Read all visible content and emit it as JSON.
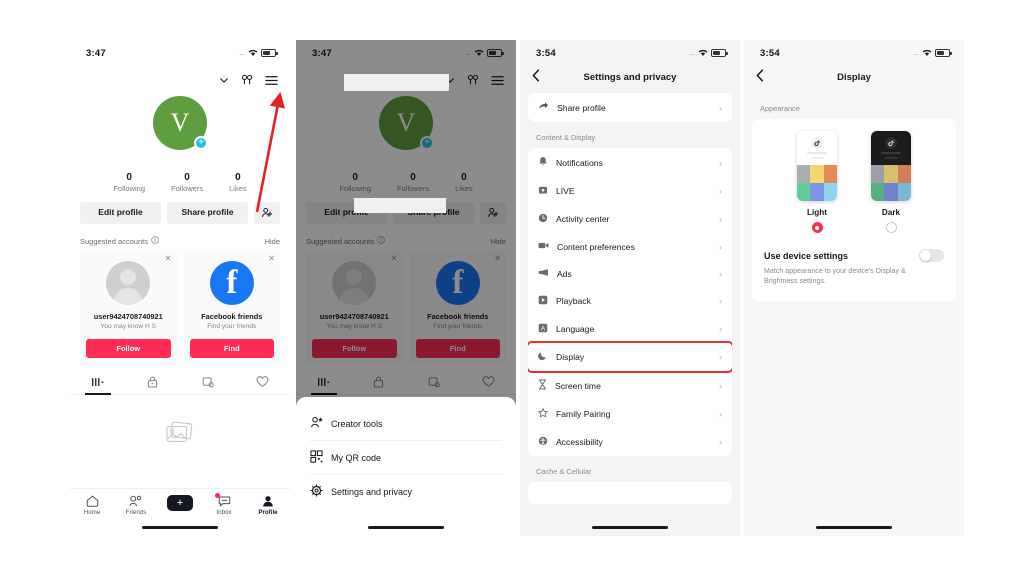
{
  "panels": {
    "profile": {
      "status": {
        "time": "3:47",
        "dots": "....",
        "wifi_icon": "wifi-icon",
        "battery_icon": "battery-icon"
      },
      "header": {
        "chevron_icon": "chevron-down-icon",
        "friends_icon": "add-friends-icon",
        "menu_icon": "hamburger-menu-icon"
      },
      "avatar": {
        "letter": "V",
        "bg_color": "#5f9e3f",
        "badge_icon": "plus-badge-icon"
      },
      "stats": [
        {
          "value": "0",
          "label": "Following"
        },
        {
          "value": "0",
          "label": "Followers"
        },
        {
          "value": "0",
          "label": "Likes"
        }
      ],
      "buttons": {
        "edit": "Edit profile",
        "share": "Share profile",
        "add_icon": "add-person-icon"
      },
      "suggested": {
        "title": "Suggested accounts",
        "info_icon": "info-icon",
        "hide": "Hide",
        "cards": [
          {
            "avatar_icon": "default-user-avatar",
            "name": "user9424708740921",
            "sub": "You may know H S",
            "cta": "Follow",
            "close_icon": "close-icon"
          },
          {
            "avatar_icon": "facebook-logo",
            "name": "Facebook friends",
            "sub": "Find your friends",
            "cta": "Find",
            "close_icon": "close-icon"
          }
        ]
      },
      "tabs": [
        {
          "icon": "grid-posts-icon",
          "active": true
        },
        {
          "icon": "lock-private-icon",
          "active": false
        },
        {
          "icon": "repost-icon",
          "active": false
        },
        {
          "icon": "heart-liked-icon",
          "active": false
        }
      ],
      "empty_icon": "photo-placeholder-icon",
      "bottom_nav": [
        {
          "icon": "home-icon",
          "label": "Home",
          "active": false
        },
        {
          "icon": "friends-icon",
          "label": "Friends",
          "active": false
        },
        {
          "icon": "create-plus-icon",
          "label": "",
          "active": false
        },
        {
          "icon": "inbox-icon",
          "label": "Inbox",
          "active": false,
          "badge": true
        },
        {
          "icon": "profile-icon",
          "label": "Profile",
          "active": true
        }
      ]
    },
    "menu": {
      "status": {
        "time": "3:47",
        "dots": "...."
      },
      "items": [
        {
          "icon": "creator-tools-icon",
          "label": "Creator tools"
        },
        {
          "icon": "qr-code-icon",
          "label": "My QR code"
        },
        {
          "icon": "settings-gear-icon",
          "label": "Settings and privacy"
        }
      ]
    },
    "settings": {
      "status": {
        "time": "3:54",
        "dots": "...."
      },
      "title": "Settings and privacy",
      "back_icon": "back-chevron-icon",
      "top_group": [
        {
          "icon": "share-arrow-icon",
          "label": "Share profile",
          "chevron": "›"
        }
      ],
      "section_label": "Content & Display",
      "items": [
        {
          "icon": "bell-icon",
          "label": "Notifications",
          "chevron": "›",
          "highlighted": false
        },
        {
          "icon": "live-icon",
          "label": "LIVE",
          "chevron": "›",
          "highlighted": false
        },
        {
          "icon": "clock-icon",
          "label": "Activity center",
          "chevron": "›",
          "highlighted": false
        },
        {
          "icon": "video-camera-icon",
          "label": "Content preferences",
          "chevron": "›",
          "highlighted": false
        },
        {
          "icon": "megaphone-icon",
          "label": "Ads",
          "chevron": "›",
          "highlighted": false
        },
        {
          "icon": "playback-icon",
          "label": "Playback",
          "chevron": "›",
          "highlighted": false
        },
        {
          "icon": "language-icon",
          "label": "Language",
          "chevron": "›",
          "highlighted": false
        },
        {
          "icon": "moon-display-icon",
          "label": "Display",
          "chevron": "›",
          "highlighted": true
        },
        {
          "icon": "hourglass-icon",
          "label": "Screen time",
          "chevron": "›",
          "highlighted": false
        },
        {
          "icon": "family-pairing-icon",
          "label": "Family Pairing",
          "chevron": "›",
          "highlighted": false
        },
        {
          "icon": "accessibility-icon",
          "label": "Accessibility",
          "chevron": "›",
          "highlighted": false
        }
      ],
      "bottom_section_label": "Cache & Cellular"
    },
    "display": {
      "status": {
        "time": "3:54",
        "dots": "...."
      },
      "title": "Display",
      "back_icon": "back-chevron-icon",
      "section_label": "Appearance",
      "themes": [
        {
          "label": "Light",
          "selected": true,
          "preview_bg": "#ffffff",
          "logo_icon": "tiktok-note-icon",
          "swatches": [
            "#a9aeb3",
            "#f5d76e",
            "#e8895a",
            "#5ecf9a",
            "#7b93e8",
            "#8fd4ef"
          ]
        },
        {
          "label": "Dark",
          "selected": false,
          "preview_bg": "#1c1c1e",
          "logo_icon": "tiktok-note-icon",
          "swatches": [
            "#9aa0a6",
            "#d6c06a",
            "#cf8055",
            "#57b184",
            "#6f83cf",
            "#7ab8d6"
          ]
        }
      ],
      "device_setting": {
        "label": "Use device settings",
        "description": "Match appearance to your device's Display & Brightness settings.",
        "toggle_on": false
      }
    }
  },
  "annotation": {
    "arrow_icon": "red-arrow-annotation",
    "arrow_color": "#e32222",
    "highlight_color": "#ef2b2b"
  }
}
